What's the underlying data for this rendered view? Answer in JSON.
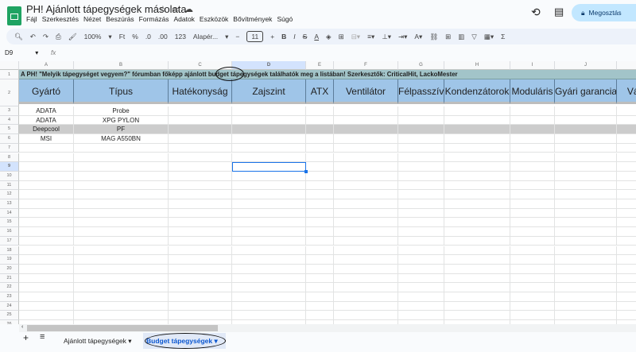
{
  "doc": {
    "title": "PH! Ajánlott tápegységek másolata"
  },
  "menu": [
    "Fájl",
    "Szerkesztés",
    "Nézet",
    "Beszúrás",
    "Formázás",
    "Adatok",
    "Eszközök",
    "Bővítmények",
    "Súgó"
  ],
  "share_label": "Megosztás",
  "toolbar": {
    "zoom": "100%",
    "currency": "Ft",
    "percent": "%",
    "dec_less": ".0",
    "dec_more": ".00",
    "format": "123",
    "font": "Alapér...",
    "font_size": "11",
    "bold": "B",
    "italic": "I"
  },
  "namebox": "D9",
  "fx": "fx",
  "columns": [
    "A",
    "B",
    "C",
    "D",
    "E",
    "F",
    "G",
    "H",
    "I",
    "J"
  ],
  "title_row": "A PH! \"Melyik tápegységet vegyem?\" fórumban főképp ajánlott budget tápegységek találhatók meg a listában! Szerkesztők: CriticalHit, LackoMester",
  "headers": [
    "Gyártó",
    "Típus",
    "Hatékonyság",
    "Zajszint",
    "ATX",
    "Ventilátor",
    "Félpasszív",
    "Kondenzátorok",
    "Moduláris",
    "Gyári garancia",
    "Vásá"
  ],
  "rows": [
    [
      "ADATA",
      "Probe"
    ],
    [
      "ADATA",
      "XPG PYLON"
    ],
    [
      "Deepcool",
      "PF"
    ],
    [
      "MSI",
      "MAG A550BN"
    ]
  ],
  "sheets": [
    "Ajánlott tápegységek",
    "Budget tápegységek"
  ],
  "active_sheet": "Budget tápegységek",
  "colors": {
    "title_bg": "#a2c4c9",
    "header_bg": "#9fc5e8",
    "highlight_row": "#cccccc",
    "accent": "#1a73e8"
  }
}
